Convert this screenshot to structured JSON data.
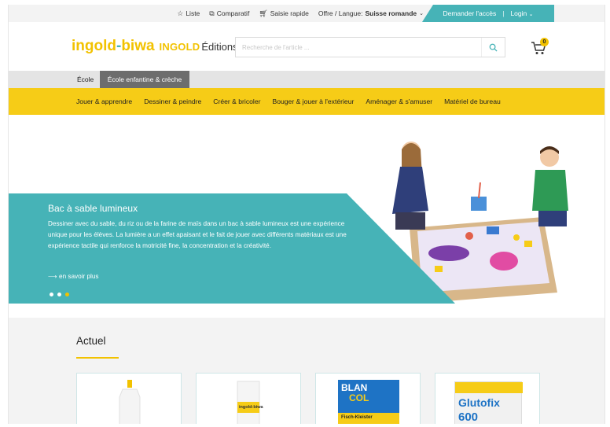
{
  "topbar": {
    "links": [
      {
        "label": "Liste",
        "icon": "star-icon"
      },
      {
        "label": "Comparatif",
        "icon": "compare-icon"
      },
      {
        "label": "Saisie rapide",
        "icon": "cart-outline-icon"
      }
    ],
    "offer_label": "Offre / Langue:",
    "offer_value": "Suisse romande",
    "access_label": "Demander l'accès",
    "separator": "|",
    "login_label": "Login"
  },
  "header": {
    "logo_part1": "ingold",
    "logo_dot": "-",
    "logo_part2": "biwa",
    "logo_brand": "INGOLD",
    "logo_editions": "Éditions",
    "search_placeholder": "Recherche de l'article ...",
    "cart_count": "0"
  },
  "tabs": [
    {
      "label": "École",
      "active": false
    },
    {
      "label": "École enfantine & crèche",
      "active": true
    }
  ],
  "nav": [
    "Jouer & apprendre",
    "Dessiner & peindre",
    "Créer & bricoler",
    "Bouger & jouer à l'extérieur",
    "Aménager & s'amuser",
    "Matériel de bureau"
  ],
  "hero": {
    "title": "Bac à sable lumineux",
    "text": "Dessiner avec du sable, du riz ou de la farine de maïs dans un bac à sable lumineux est une expérience unique pour les élèves. La lumière a un effet apaisant et le fait de jouer avec différents matériaux est une expérience tactile qui renforce la motricité fine, la concentration et la créativité.",
    "more_label": "⟶ en savoir plus",
    "slides": 3,
    "active_slide": 3
  },
  "section": {
    "title": "Actuel",
    "products": [
      {
        "label": ""
      },
      {
        "label": "ingold-biwa"
      },
      {
        "label_top": "BLAN",
        "label_mid": "COL",
        "label_bottom": "Fisch-Kleister"
      },
      {
        "label_top": "Glutofix",
        "label_mid": "600"
      }
    ]
  },
  "colors": {
    "accent_teal": "#46b3b7",
    "brand_yellow": "#f6cc17",
    "tab_active": "#6d6d6d"
  }
}
